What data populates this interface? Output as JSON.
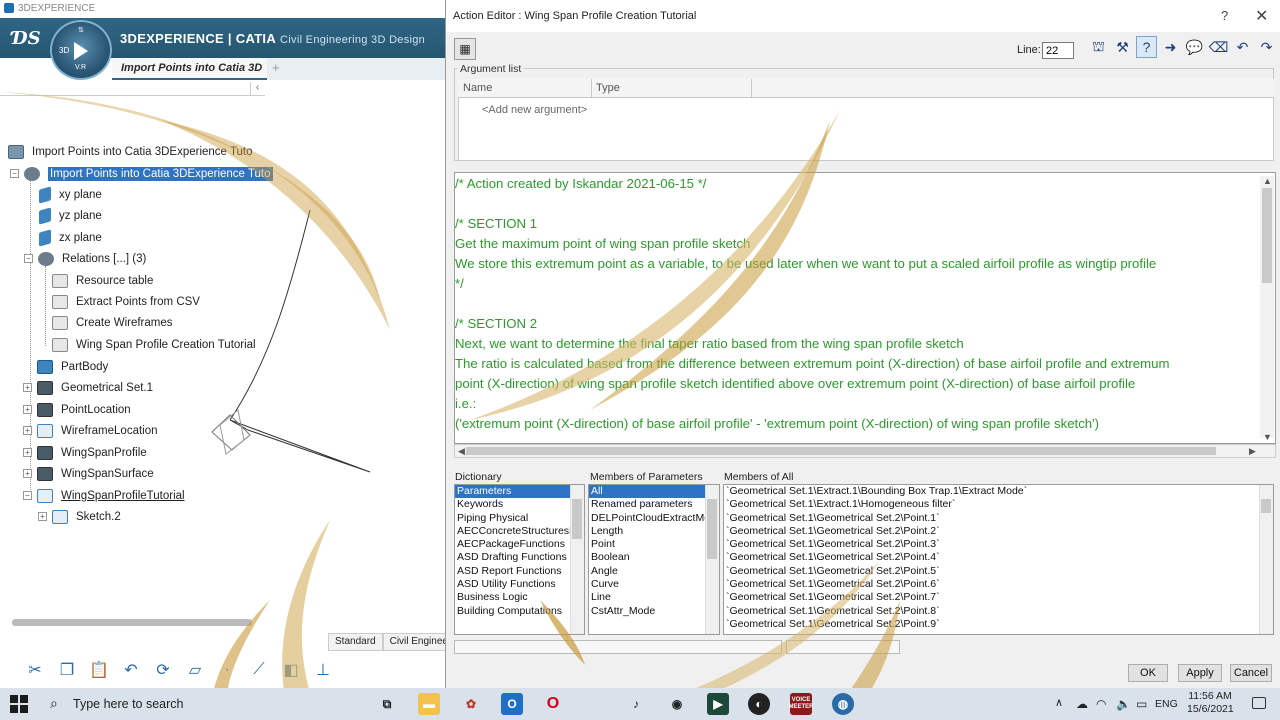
{
  "app": {
    "window_title": "3DEXPERIENCE",
    "brand_main": "3DEXPERIENCE | CATIA",
    "brand_sub": "Civil Engineering 3D Design",
    "compass_3d": "3D",
    "compass_vr": "V.R",
    "active_tab": "Import Points into Catia 3D",
    "tab_plus": "+"
  },
  "tree": {
    "root": "Import Points into Catia 3DExperience Tuto",
    "selected": "Import Points into Catia 3DExperience Tuto",
    "items": [
      {
        "label": "xy plane"
      },
      {
        "label": "yz plane"
      },
      {
        "label": "zx plane"
      },
      {
        "label": "Relations [...] (3)"
      },
      {
        "label": "Resource table"
      },
      {
        "label": "Extract Points from CSV"
      },
      {
        "label": "Create Wireframes"
      },
      {
        "label": "Wing Span Profile Creation Tutorial"
      },
      {
        "label": "PartBody"
      },
      {
        "label": "Geometrical Set.1"
      },
      {
        "label": "PointLocation"
      },
      {
        "label": "WireframeLocation"
      },
      {
        "label": "WingSpanProfile"
      },
      {
        "label": "WingSpanSurface"
      },
      {
        "label": "WingSpanProfileTutorial"
      },
      {
        "label": "Sketch.2"
      }
    ]
  },
  "bottom_tabs": [
    "Standard",
    "Civil Enginee"
  ],
  "dialog": {
    "title": "Action Editor : Wing Span Profile Creation Tutorial",
    "help": "?",
    "close": "✕",
    "line_label": "Line:",
    "line_value": "22",
    "argument_list": {
      "legend": "Argument list",
      "col_name": "Name",
      "col_type": "Type",
      "add_row": "<Add new argument>"
    },
    "script_lines": [
      "/* Action created by Iskandar 2021-06-15 */",
      "",
      "/* SECTION 1",
      "Get the maximum point of wing span profile sketch",
      "We store this extremum point as a variable, to be used later when we want to put a scaled airfoil profile as wingtip profile",
      "*/",
      "",
      "/* SECTION 2",
      "Next, we want to determine the final taper ratio based from the wing span profile sketch",
      "The ratio is calculated based from the difference between extremum point (X-direction) of base airfoil profile and extremum",
      "point (X-direction) of wing span profile sketch identified above over extremum point (X-direction) of base airfoil profile",
      "i.e.:",
      "('extremum point (X-direction) of base airfoil profile' - 'extremum point (X-direction) of wing span profile sketch')"
    ],
    "dictionary": {
      "label": "Dictionary",
      "items": [
        "Parameters",
        "Keywords",
        "Piping Physical",
        "AECConcreteStructuresFun",
        "AECPackageFunctions",
        "ASD Drafting Functions",
        "ASD Report Functions",
        "ASD Utility Functions",
        "Business Logic",
        "Building Computations"
      ],
      "selected": "Parameters"
    },
    "members_of_parameters": {
      "label": "Members of Parameters",
      "items": [
        "All",
        "Renamed parameters",
        "DELPointCloudExtractMod",
        "Length",
        "Point",
        "Boolean",
        "Angle",
        "Curve",
        "Line",
        "CstAttr_Mode"
      ],
      "selected": "All"
    },
    "members_of_all": {
      "label": "Members of All",
      "items": [
        "`Geometrical Set.1\\Extract.1\\Bounding Box Trap.1\\Extract Mode`",
        "`Geometrical Set.1\\Extract.1\\Homogeneous filter`",
        "`Geometrical Set.1\\Geometrical Set.2\\Point.1`",
        "`Geometrical Set.1\\Geometrical Set.2\\Point.2`",
        "`Geometrical Set.1\\Geometrical Set.2\\Point.3`",
        "`Geometrical Set.1\\Geometrical Set.2\\Point.4`",
        "`Geometrical Set.1\\Geometrical Set.2\\Point.5`",
        "`Geometrical Set.1\\Geometrical Set.2\\Point.6`",
        "`Geometrical Set.1\\Geometrical Set.2\\Point.7`",
        "`Geometrical Set.1\\Geometrical Set.2\\Point.8`",
        "`Geometrical Set.1\\Geometrical Set.2\\Point.9`"
      ]
    },
    "buttons": {
      "ok": "OK",
      "apply": "Apply",
      "cancel": "Cancel"
    }
  },
  "taskbar": {
    "search_placeholder": "Type here to search",
    "voice_meeter": "VOICE MEETER",
    "lang": "ENG",
    "time": "11:56 AM",
    "date": "15/6/2021"
  }
}
